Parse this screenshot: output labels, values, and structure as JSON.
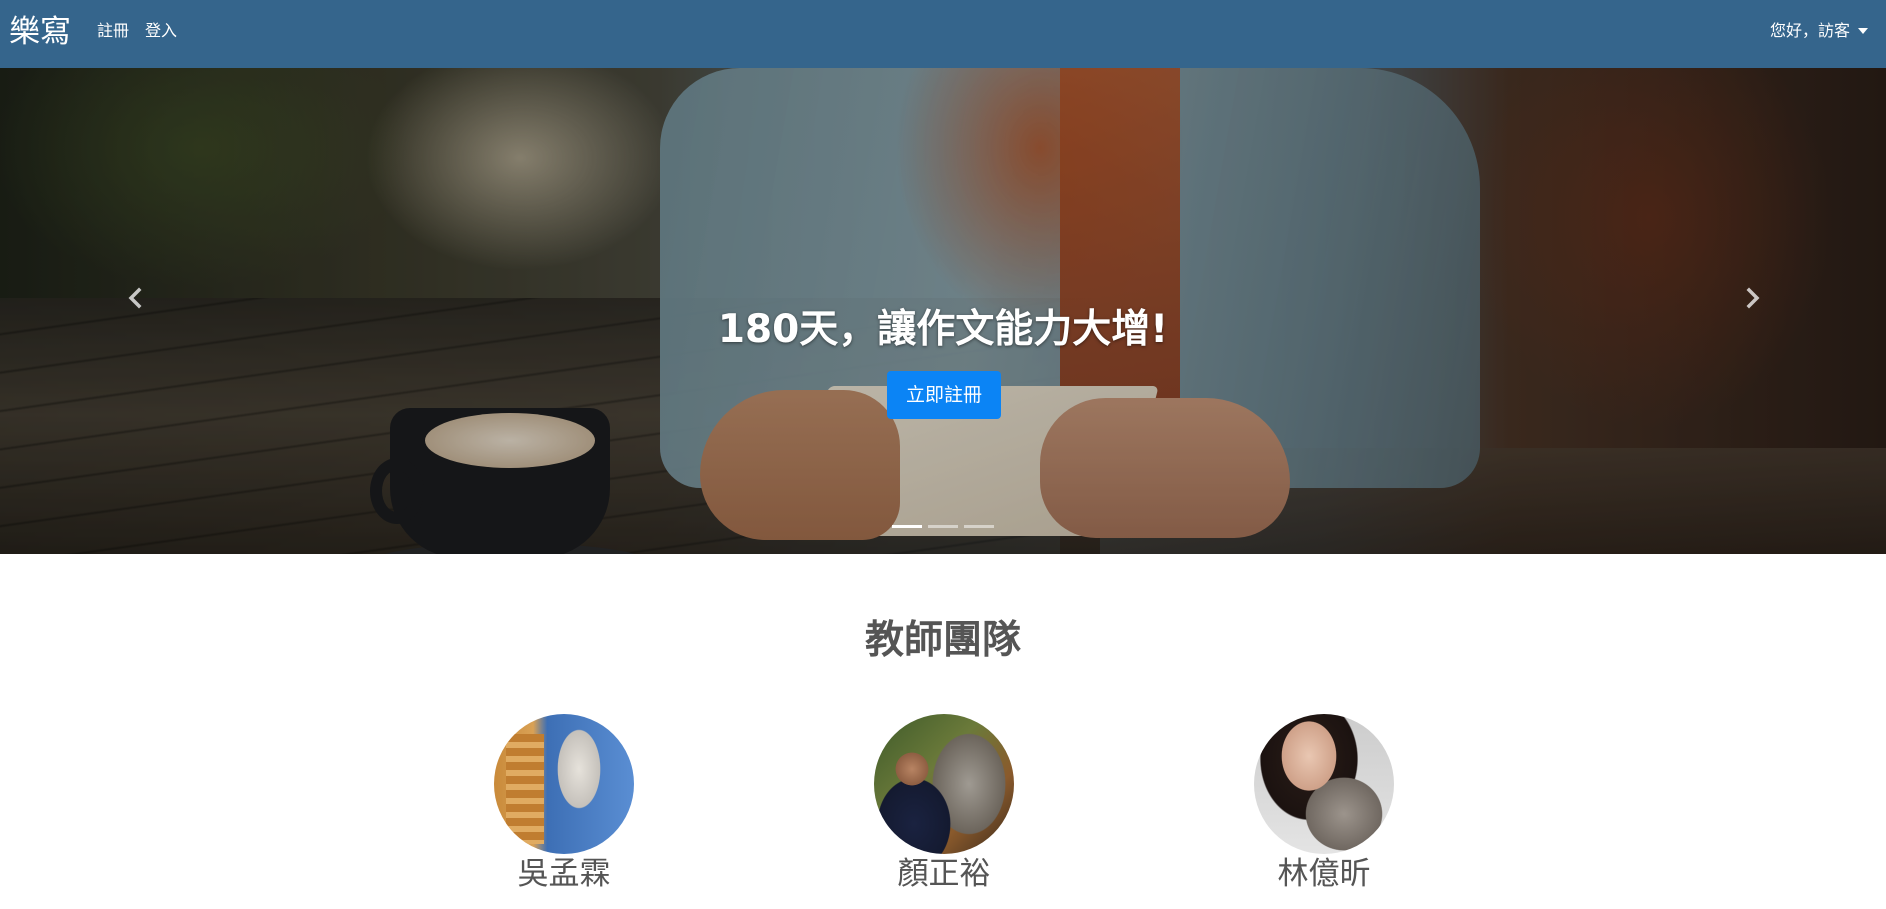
{
  "navbar": {
    "brand": "樂寫",
    "links": {
      "register": "註冊",
      "login": "登入"
    },
    "user_menu": "您好，訪客",
    "background_color": "#35658c"
  },
  "hero": {
    "headline": "180天，讓作文能力大增!",
    "cta_label": "立即註冊",
    "cta_color": "#0b84f5",
    "prev_icon": "chevron-left-icon",
    "next_icon": "chevron-right-icon",
    "slides_count": 3,
    "active_slide": 1
  },
  "team": {
    "title": "教師團隊",
    "members": [
      {
        "name": "吳孟霖"
      },
      {
        "name": "顏正裕"
      },
      {
        "name": "林億昕"
      }
    ]
  }
}
